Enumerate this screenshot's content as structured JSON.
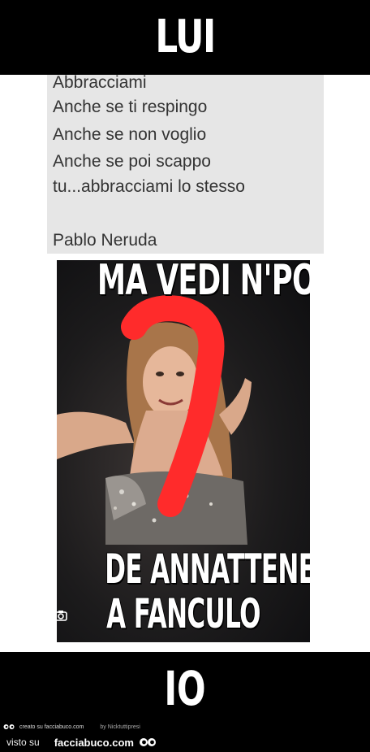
{
  "top_label": "LUI",
  "quote": {
    "lines": [
      "Abbracciami",
      "Anche se ti respingo",
      "Anche se non voglio",
      "Anche se poi scappo",
      "tu...abbracciami lo stesso",
      "",
      "Pablo Neruda"
    ]
  },
  "meme": {
    "top_text": "MA VEDI N'PO",
    "bottom_line1": "DE ANNATTENE",
    "bottom_line2": "A FANCULO"
  },
  "bottom_label": "IO",
  "footer": {
    "credit": "creato su facciabuco.com",
    "by": "by Nicktuttipresi",
    "visto": "visto su",
    "site": "facciabuco.com"
  },
  "colors": {
    "scribble": "#ff2b2b",
    "band": "#000000",
    "quote_bg": "#e6e6e6"
  }
}
